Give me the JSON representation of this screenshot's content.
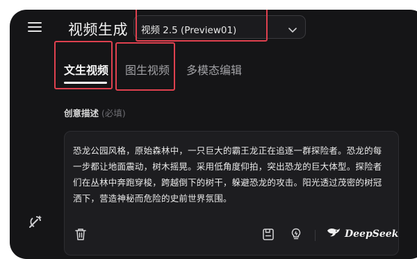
{
  "header": {
    "title": "视频生成",
    "model_select_value": "视频 2.5 (Preview01)"
  },
  "tabs": [
    {
      "label": "文生视频",
      "active": true
    },
    {
      "label": "图生视频",
      "active": false
    },
    {
      "label": "多模态编辑",
      "active": false
    }
  ],
  "prompt_section": {
    "label": "创意描述",
    "optional_hint": "(必填)",
    "lines": [
      "恐龙公园风格，原始森林中，一只巨大的霸王龙正在追逐一群探险者。恐龙的每",
      "一步都让地面震动，树木摇晃。采用低角度仰拍，突出恐龙的巨大体型。探险者",
      "们在丛林中奔跑穿梭，跨越倒下的树干，躲避恐龙的攻击。阳光透过茂密的树冠",
      "洒下，营造神秘而危险的史前世界氛围。"
    ]
  },
  "toolbar": {
    "brand_label": "DeepSeek"
  },
  "icons": {
    "menu": "menu-icon",
    "bottom": "magic-wand-icon",
    "trash": "trash-icon",
    "save": "save-icon",
    "bulb": "lightbulb-icon",
    "dropdown": "chevron-down-icon",
    "brand": "deepseek-whale-icon"
  },
  "colors": {
    "panel_bg": "#151517",
    "card_bg": "#1d1d20",
    "highlight_red": "#e0414f",
    "text_primary": "#f5f5f5",
    "text_muted": "#a2a2a6"
  }
}
